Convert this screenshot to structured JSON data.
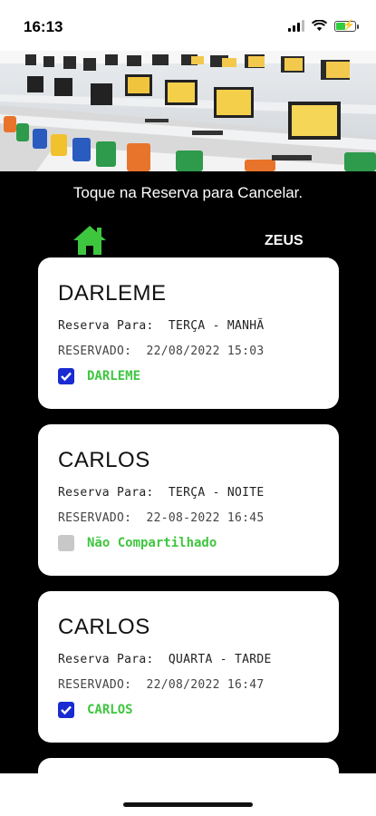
{
  "status": {
    "time": "16:13"
  },
  "header": {
    "title": "Toque na Reserva para Cancelar.",
    "user": "ZEUS"
  },
  "colors": {
    "accent_green": "#3fc63f",
    "checkbox_blue": "#1a2bd1",
    "home_green": "#3fc63f"
  },
  "icons": {
    "home": "home-icon",
    "check": "check-icon"
  },
  "reservations": [
    {
      "name": "DARLEME",
      "line1": "Reserva Para:  TERÇA - MANHÃ",
      "line2": "RESERVADO:  22/08/2022 15:03",
      "shared": true,
      "check_label": "DARLEME"
    },
    {
      "name": "CARLOS",
      "line1": "Reserva Para:  TERÇA - NOITE",
      "line2": "RESERVADO:  22-08-2022 16:45",
      "shared": false,
      "check_label": "Não Compartilhado"
    },
    {
      "name": "CARLOS",
      "line1": "Reserva Para:  QUARTA - TARDE",
      "line2": "RESERVADO:  22/08/2022 16:47",
      "shared": true,
      "check_label": "CARLOS"
    }
  ]
}
